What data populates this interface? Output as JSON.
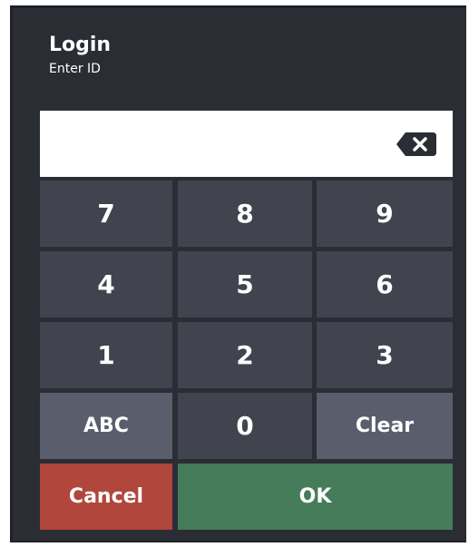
{
  "dialog": {
    "title": "Login",
    "subtitle": "Enter ID"
  },
  "input": {
    "value": "",
    "backspace_icon": "backspace-icon"
  },
  "keypad": {
    "rows": [
      [
        "7",
        "8",
        "9"
      ],
      [
        "4",
        "5",
        "6"
      ],
      [
        "1",
        "2",
        "3"
      ]
    ],
    "abc_label": "ABC",
    "zero_label": "0",
    "clear_label": "Clear"
  },
  "actions": {
    "cancel_label": "Cancel",
    "ok_label": "OK"
  },
  "colors": {
    "background": "#2b2d35",
    "key": "#41434f",
    "function_key": "#5a5d6c",
    "cancel": "#b0463c",
    "ok": "#457c5a"
  }
}
